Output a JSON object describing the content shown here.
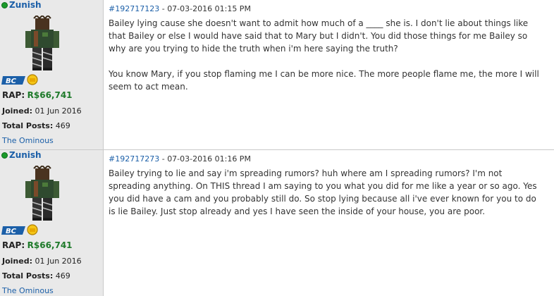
{
  "posts": [
    {
      "username": "Zunish",
      "badge": "BC",
      "rap_label": "RAP:",
      "rap_value": "R$66,741",
      "joined_label": "Joined:",
      "joined_value": "01 Jun 2016",
      "posts_label": "Total Posts:",
      "posts_value": "469",
      "group": "The Ominous",
      "post_id": "#192717123",
      "timestamp": "07-03-2016 01:15 PM",
      "body": [
        "Bailey lying cause she doesn't want to admit how much of a ____ she is. I don't lie about things like that Bailey or else I would have said that to Mary but I didn't. You did those things for me Bailey so why are you trying to hide the truth when i'm here saying the truth?",
        "You know Mary, if you stop flaming me I can be more nice. The more people flame me, the more I will seem to act mean."
      ]
    },
    {
      "username": "Zunish",
      "badge": "BC",
      "rap_label": "RAP:",
      "rap_value": "R$66,741",
      "joined_label": "Joined:",
      "joined_value": "01 Jun 2016",
      "posts_label": "Total Posts:",
      "posts_value": "469",
      "group": "The Ominous",
      "post_id": "#192717273",
      "timestamp": "07-03-2016 01:16 PM",
      "body": [
        "Bailey trying to lie and say i'm spreading rumors? huh where am I spreading rumors? I'm not spreading anything. On THIS thread I am saying to you what you did for me like a year or so ago. Yes you did have a cam and you probably still do. So stop lying because all i've ever known for you to do is lie Bailey. Just stop already and yes I have seen the inside of your house, you are poor."
      ]
    }
  ],
  "colors": {
    "link": "#1b5fa8",
    "rap": "#1e7a2a",
    "sidebar_bg": "#e9e9e9",
    "online": "#1a9a2a"
  },
  "icons": {
    "online": "online-status-icon",
    "badge": "builders-club-badge-icon",
    "avatar": "avatar-icon"
  }
}
